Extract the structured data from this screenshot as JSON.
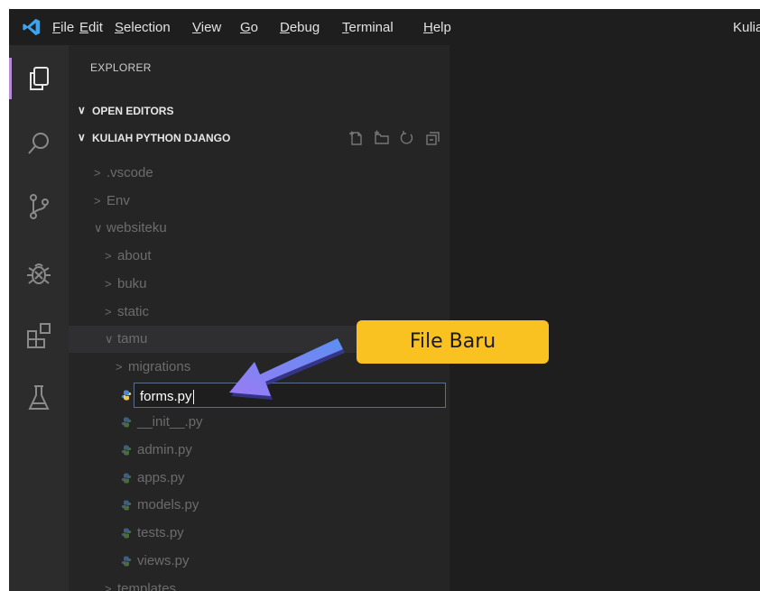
{
  "menu": [
    "File",
    "Edit",
    "Selection",
    "View",
    "Go",
    "Debug",
    "Terminal",
    "Help"
  ],
  "menu_mnemonic": [
    "F",
    "E",
    "S",
    "V",
    "G",
    "D",
    "T",
    "H"
  ],
  "menu_rest": [
    "ile",
    "dit",
    "election",
    "iew",
    "o",
    "ebug",
    "erminal",
    "elp"
  ],
  "window_title": "Kulia",
  "activity_bar": [
    "explorer-icon",
    "search-icon",
    "source-control-icon",
    "debug-icon",
    "extensions-icon",
    "testing-icon"
  ],
  "explorer": {
    "header": "EXPLORER",
    "open_editors": "OPEN EDITORS",
    "project": "KULIAH PYTHON DJANGO",
    "tree": [
      {
        "label": ".vscode",
        "type": "folder",
        "expanded": false,
        "depth": 0
      },
      {
        "label": "Env",
        "type": "folder",
        "expanded": false,
        "depth": 0
      },
      {
        "label": "websiteku",
        "type": "folder",
        "expanded": true,
        "depth": 0
      },
      {
        "label": "about",
        "type": "folder",
        "expanded": false,
        "depth": 1
      },
      {
        "label": "buku",
        "type": "folder",
        "expanded": false,
        "depth": 1
      },
      {
        "label": "static",
        "type": "folder",
        "expanded": false,
        "depth": 1
      },
      {
        "label": "tamu",
        "type": "folder",
        "expanded": true,
        "depth": 1
      },
      {
        "label": "migrations",
        "type": "folder",
        "expanded": false,
        "depth": 2
      },
      {
        "label": "forms.py",
        "type": "new-file-input",
        "depth": 2
      },
      {
        "label": "__init__.py",
        "type": "py",
        "depth": 2
      },
      {
        "label": "admin.py",
        "type": "py",
        "depth": 2
      },
      {
        "label": "apps.py",
        "type": "py",
        "depth": 2
      },
      {
        "label": "models.py",
        "type": "py",
        "depth": 2
      },
      {
        "label": "tests.py",
        "type": "py",
        "depth": 2
      },
      {
        "label": "views.py",
        "type": "py",
        "depth": 2
      },
      {
        "label": "templates",
        "type": "folder",
        "expanded": false,
        "depth": 1
      }
    ]
  },
  "callout": {
    "label": "File Baru"
  },
  "colors": {
    "accent": "#b58ad6",
    "callout": "#f9c221",
    "arrow": "#7d78f0"
  }
}
